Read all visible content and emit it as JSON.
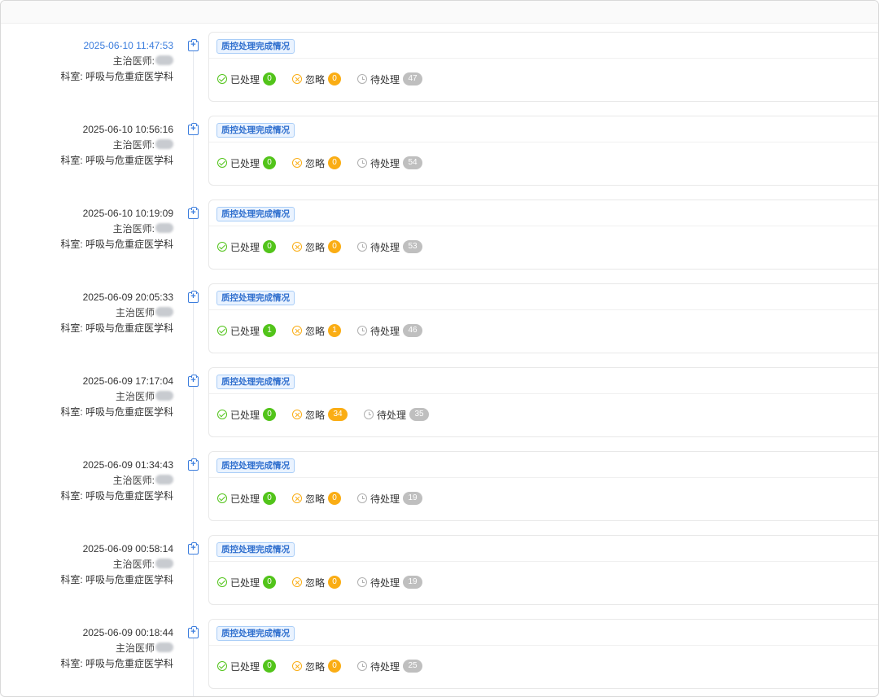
{
  "labels": {
    "doctor_prefix": "主治医师:",
    "doctor_prefix_alt": "主治医师",
    "department": "科室: 呼吸与危重症医学科",
    "card_tag": "质控处理完成情况",
    "processed": "已处理",
    "ignored": "忽略",
    "pending": "待处理"
  },
  "colors": {
    "accent": "#3b7ddd",
    "processed": "#52c41a",
    "ignored": "#faad14",
    "pending": "#bfbfbf"
  },
  "entries": [
    {
      "time": "2025-06-10 11:47:53",
      "processed": "0",
      "ignored": "0",
      "pending": "47"
    },
    {
      "time": "2025-06-10 10:56:16",
      "processed": "0",
      "ignored": "0",
      "pending": "54"
    },
    {
      "time": "2025-06-10 10:19:09",
      "processed": "0",
      "ignored": "0",
      "pending": "53"
    },
    {
      "time": "2025-06-09 20:05:33",
      "processed": "1",
      "ignored": "1",
      "pending": "46"
    },
    {
      "time": "2025-06-09 17:17:04",
      "processed": "0",
      "ignored": "34",
      "pending": "35"
    },
    {
      "time": "2025-06-09 01:34:43",
      "processed": "0",
      "ignored": "0",
      "pending": "19"
    },
    {
      "time": "2025-06-09 00:58:14",
      "processed": "0",
      "ignored": "0",
      "pending": "19"
    },
    {
      "time": "2025-06-09 00:18:44",
      "processed": "0",
      "ignored": "0",
      "pending": "25"
    }
  ]
}
